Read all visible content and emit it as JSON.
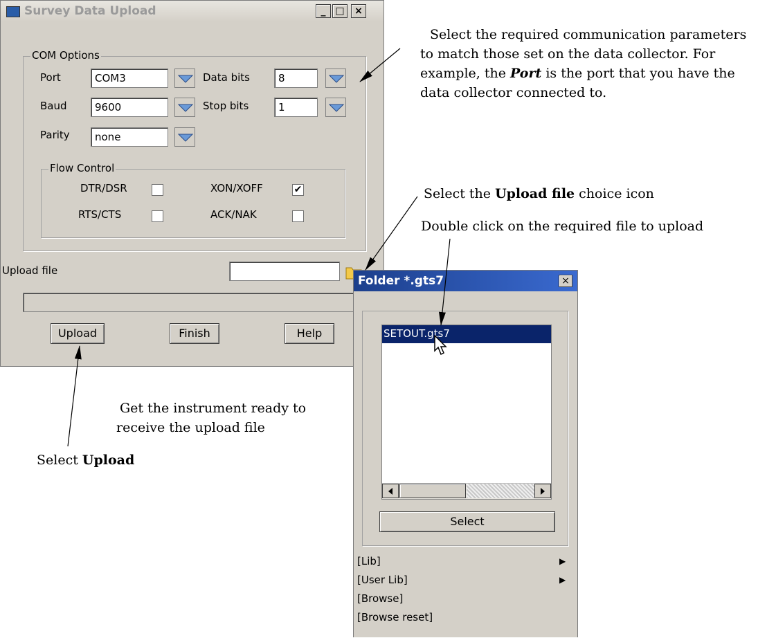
{
  "main_window": {
    "title": "Survey Data Upload",
    "min_label": "_",
    "max_label": "□",
    "close_label": "×",
    "com_group": "COM Options",
    "port_label": "Port",
    "port_value": "COM3",
    "baud_label": "Baud",
    "baud_value": "9600",
    "parity_label": "Parity",
    "parity_value": "none",
    "databits_label": "Data bits",
    "databits_value": "8",
    "stopbits_label": "Stop bits",
    "stopbits_value": "1",
    "flow_group": "Flow Control",
    "dtr_label": "DTR/DSR",
    "rts_label": "RTS/CTS",
    "xon_label": "XON/XOFF",
    "ack_label": "ACK/NAK",
    "xon_checked_mark": "✔",
    "upload_file_label": "Upload file",
    "upload_file_value": "",
    "buttons": {
      "upload": "Upload",
      "finish": "Finish",
      "help": "Help"
    }
  },
  "folder_window": {
    "title": "Folder *.gts7",
    "close_label": "×",
    "file_item": "SETOUT.gts7",
    "select_button": "Select",
    "menu": [
      "[Lib]",
      "[User Lib]",
      "[Browse]",
      "[Browse reset]"
    ]
  },
  "annotations": {
    "com_text_1": "Select the required communication parameters",
    "com_text_2": "to match those set on the data collector. For",
    "com_text_3_pre": "example, the ",
    "com_text_3_em": "Port",
    "com_text_3_post": " is the port that you have the",
    "com_text_4": "data collector connected to.",
    "upload_icon_pre": "Select the ",
    "upload_icon_bold": "Upload file",
    "upload_icon_post": " choice icon",
    "double_click": "Double click on the required file to upload",
    "ready_1": "Get the instrument ready to",
    "ready_2": "receive the upload file",
    "select_upload_pre": "Select ",
    "select_upload_bold": "Upload"
  }
}
